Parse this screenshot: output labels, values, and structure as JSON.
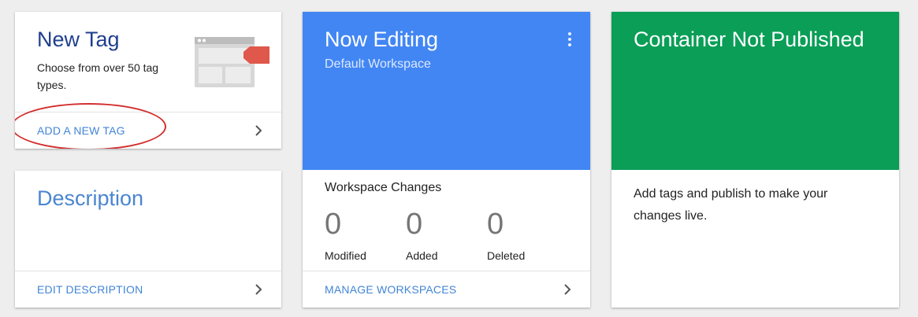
{
  "new_tag_card": {
    "title": "New Tag",
    "subtitle": "Choose from over 50 tag types.",
    "action_label": "ADD A NEW TAG",
    "illustration_icon": "tag-browser-icon",
    "annotation_color": "#d32f2f"
  },
  "description_card": {
    "title": "Description",
    "action_label": "EDIT DESCRIPTION"
  },
  "now_editing_card": {
    "title": "Now Editing",
    "subtitle": "Default Workspace",
    "header_color": "#4286f4",
    "changes_title": "Workspace Changes",
    "stats": [
      {
        "value": "0",
        "label": "Modified"
      },
      {
        "value": "0",
        "label": "Added"
      },
      {
        "value": "0",
        "label": "Deleted"
      }
    ],
    "action_label": "MANAGE WORKSPACES"
  },
  "not_published_card": {
    "title": "Container Not Published",
    "header_color": "#0a9e57",
    "body": "Add tags and publish to make your changes live."
  },
  "colors": {
    "link": "#4285d6",
    "background": "#eeeeee"
  }
}
